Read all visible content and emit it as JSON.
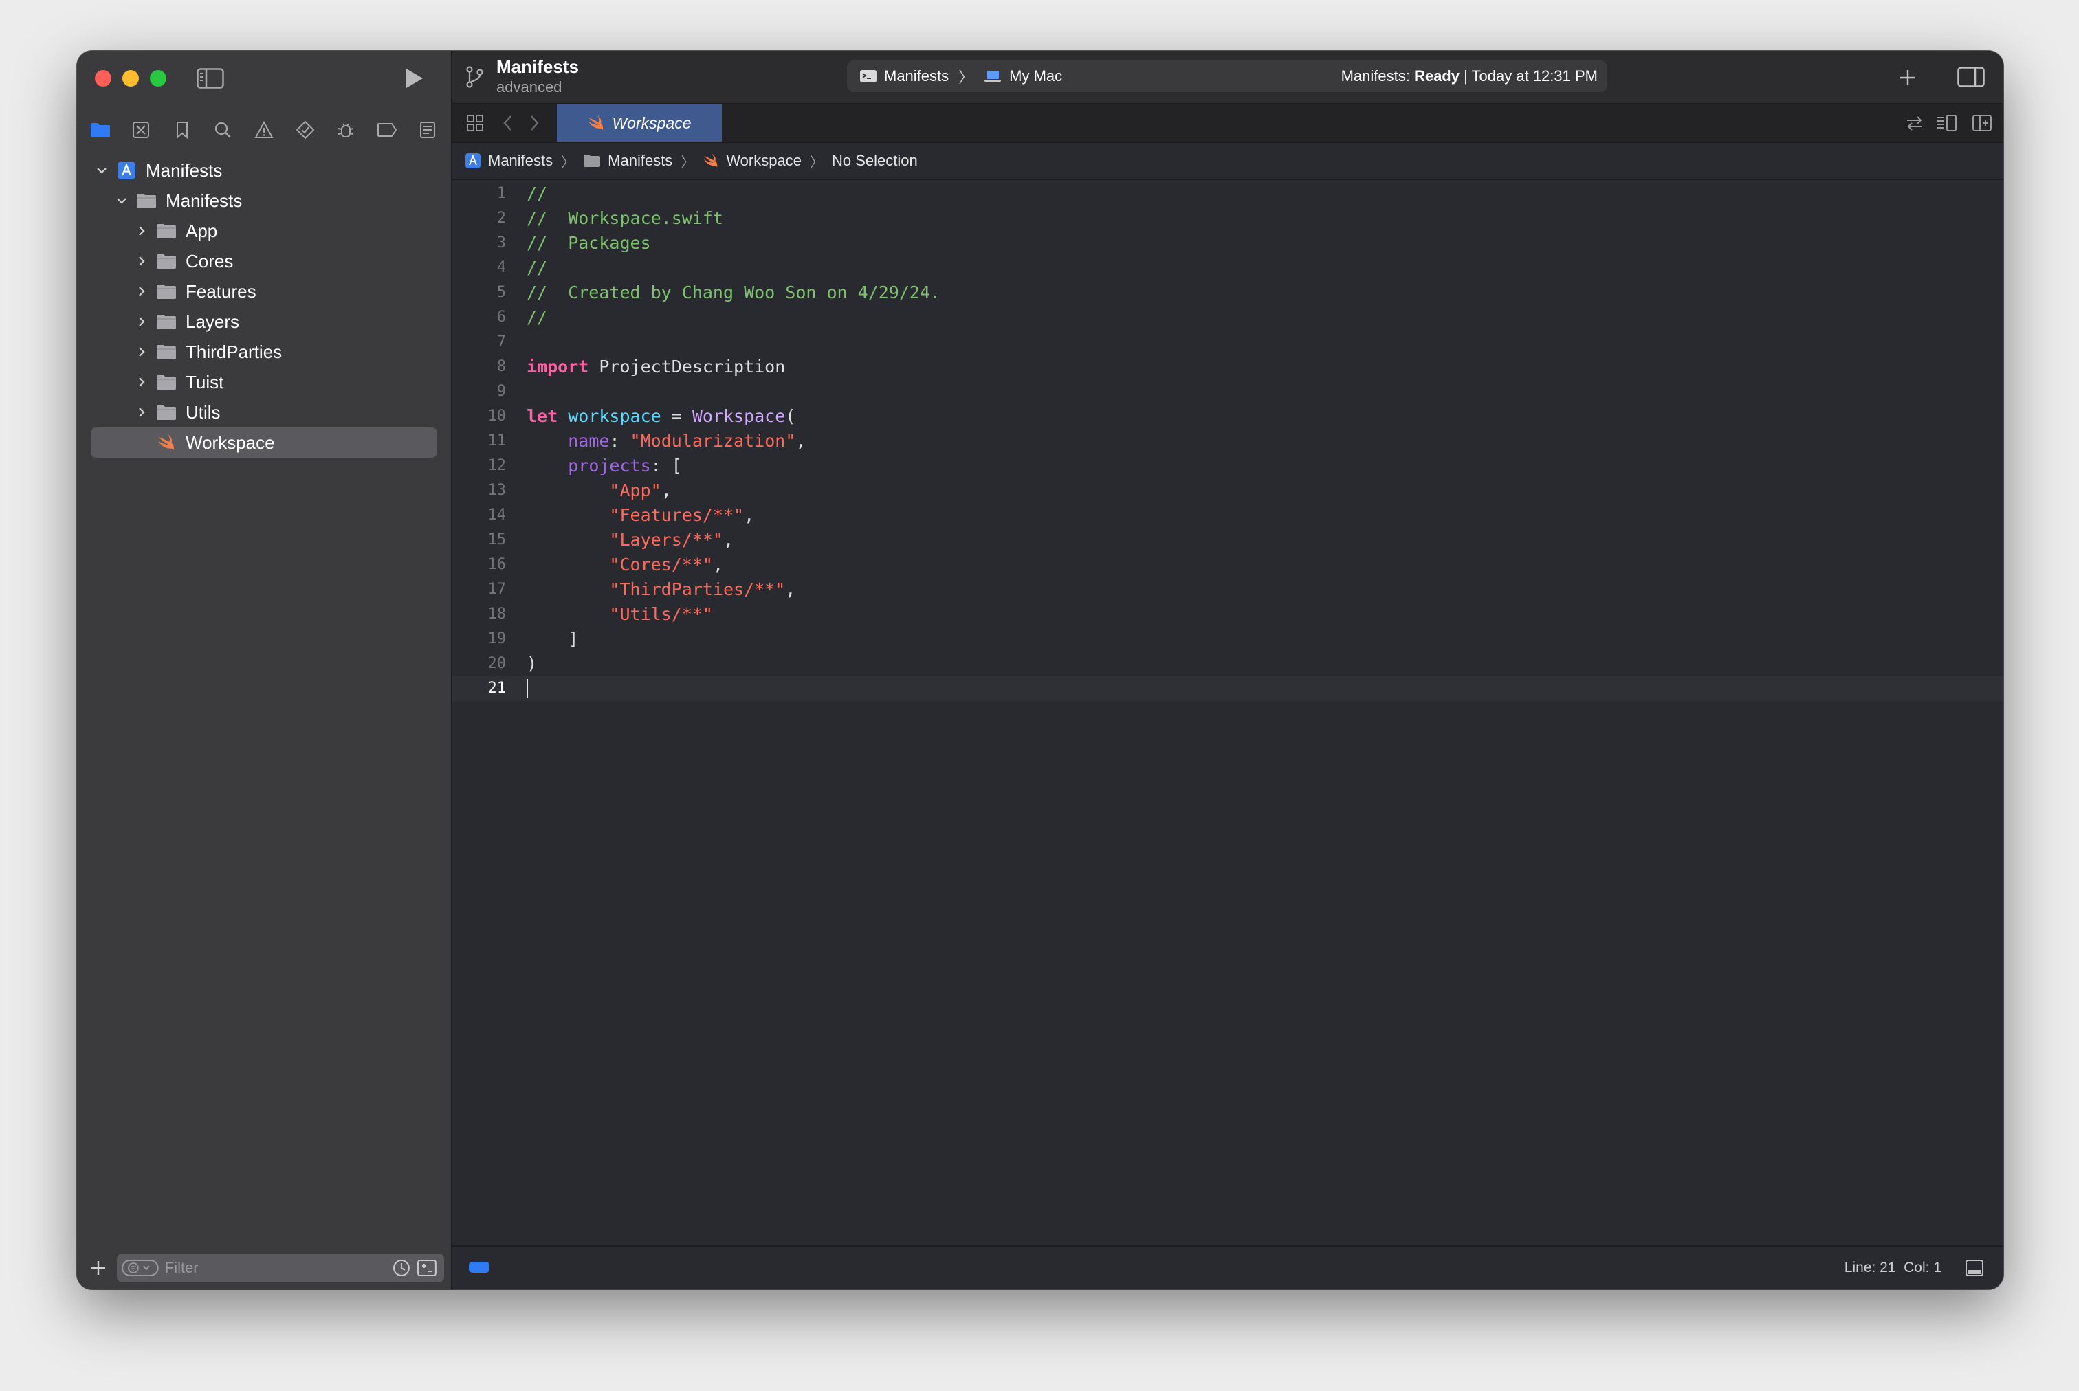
{
  "window": {
    "project": "Manifests",
    "branch": "advanced",
    "scheme": "Manifests",
    "destination": "My Mac",
    "status_prefix": "Manifests: ",
    "status_state": "Ready",
    "status_time": " | Today at 12:31 PM"
  },
  "navigator": {
    "tabs": [
      "folder-icon",
      "source-control-icon",
      "bookmark-icon",
      "search-icon",
      "warning-icon",
      "test-diamond-icon",
      "debug-icon",
      "breakpoint-icon",
      "report-icon"
    ],
    "tree": [
      {
        "label": "Manifests",
        "kind": "project",
        "level": 0,
        "expanded": true
      },
      {
        "label": "Manifests",
        "kind": "folder",
        "level": 1,
        "expanded": true
      },
      {
        "label": "App",
        "kind": "folder",
        "level": 2,
        "expanded": false
      },
      {
        "label": "Cores",
        "kind": "folder",
        "level": 2,
        "expanded": false
      },
      {
        "label": "Features",
        "kind": "folder",
        "level": 2,
        "expanded": false
      },
      {
        "label": "Layers",
        "kind": "folder",
        "level": 2,
        "expanded": false
      },
      {
        "label": "ThirdParties",
        "kind": "folder",
        "level": 2,
        "expanded": false
      },
      {
        "label": "Tuist",
        "kind": "folder",
        "level": 2,
        "expanded": false
      },
      {
        "label": "Utils",
        "kind": "folder",
        "level": 2,
        "expanded": false
      },
      {
        "label": "Workspace",
        "kind": "swift",
        "level": 2,
        "selected": true
      }
    ],
    "filter_placeholder": "Filter"
  },
  "editor": {
    "tab_label": "Workspace",
    "breadcrumb": [
      "Manifests",
      "Manifests",
      "Workspace",
      "No Selection"
    ],
    "current_line": 21,
    "lines": [
      [
        {
          "t": "//",
          "c": "comment"
        }
      ],
      [
        {
          "t": "//  Workspace.swift",
          "c": "comment"
        }
      ],
      [
        {
          "t": "//  Packages",
          "c": "comment"
        }
      ],
      [
        {
          "t": "//",
          "c": "comment"
        }
      ],
      [
        {
          "t": "//  Created by Chang Woo Son on 4/29/24.",
          "c": "comment"
        }
      ],
      [
        {
          "t": "//",
          "c": "comment"
        }
      ],
      [],
      [
        {
          "t": "import",
          "c": "kw"
        },
        {
          "t": " ProjectDescription",
          "c": "plain"
        }
      ],
      [],
      [
        {
          "t": "let",
          "c": "kw"
        },
        {
          "t": " ",
          "c": "plain"
        },
        {
          "t": "workspace",
          "c": "var"
        },
        {
          "t": " = ",
          "c": "plain"
        },
        {
          "t": "Workspace",
          "c": "type"
        },
        {
          "t": "(",
          "c": "plain"
        }
      ],
      [
        {
          "t": "    ",
          "c": "plain"
        },
        {
          "t": "name",
          "c": "prop"
        },
        {
          "t": ": ",
          "c": "plain"
        },
        {
          "t": "\"Modularization\"",
          "c": "str"
        },
        {
          "t": ",",
          "c": "plain"
        }
      ],
      [
        {
          "t": "    ",
          "c": "plain"
        },
        {
          "t": "projects",
          "c": "prop"
        },
        {
          "t": ": [",
          "c": "plain"
        }
      ],
      [
        {
          "t": "        ",
          "c": "plain"
        },
        {
          "t": "\"App\"",
          "c": "str"
        },
        {
          "t": ",",
          "c": "plain"
        }
      ],
      [
        {
          "t": "        ",
          "c": "plain"
        },
        {
          "t": "\"Features/**\"",
          "c": "str"
        },
        {
          "t": ",",
          "c": "plain"
        }
      ],
      [
        {
          "t": "        ",
          "c": "plain"
        },
        {
          "t": "\"Layers/**\"",
          "c": "str"
        },
        {
          "t": ",",
          "c": "plain"
        }
      ],
      [
        {
          "t": "        ",
          "c": "plain"
        },
        {
          "t": "\"Cores/**\"",
          "c": "str"
        },
        {
          "t": ",",
          "c": "plain"
        }
      ],
      [
        {
          "t": "        ",
          "c": "plain"
        },
        {
          "t": "\"ThirdParties/**\"",
          "c": "str"
        },
        {
          "t": ",",
          "c": "plain"
        }
      ],
      [
        {
          "t": "        ",
          "c": "plain"
        },
        {
          "t": "\"Utils/**\"",
          "c": "str"
        }
      ],
      [
        {
          "t": "    ]",
          "c": "plain"
        }
      ],
      [
        {
          "t": ")",
          "c": "plain"
        }
      ],
      []
    ]
  },
  "statusbar": {
    "cursor": "Line: 21  Col: 1"
  },
  "colors": {
    "accent": "#2f7bf5",
    "selected_tab": "#3e5a8f",
    "comment": "#7ec16e",
    "keyword": "#fc5fa3",
    "string": "#fc6a5d",
    "type": "#d0a8ff",
    "property": "#a167e6",
    "variable": "#5dd8ff"
  }
}
